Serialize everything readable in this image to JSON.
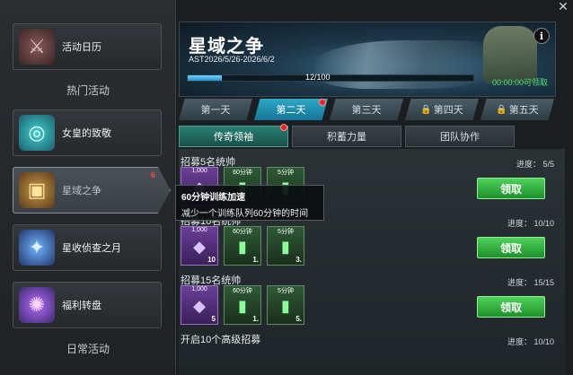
{
  "sidebar": {
    "items": [
      {
        "label": "活动日历",
        "icon": "swords-icon",
        "badge": ""
      },
      {
        "label": "女皇的致敬",
        "icon": "crest-icon",
        "badge": ""
      },
      {
        "label": "星域之争",
        "icon": "treasure-chest-icon",
        "badge": "6"
      },
      {
        "label": "星收侦查之月",
        "icon": "crystal-icon",
        "badge": ""
      },
      {
        "label": "福利转盘",
        "icon": "wheel-icon",
        "badge": ""
      }
    ],
    "section_hot": "热门活动",
    "section_daily": "日常活动"
  },
  "banner": {
    "title": "星域之争",
    "date": "AST2026/5/26-2026/6/2",
    "progress_text": "12/100",
    "progress": 0.12,
    "claim_time": "00:00:00可领取",
    "info": "i"
  },
  "days": [
    {
      "label": "第一天",
      "locked": false,
      "selected": false
    },
    {
      "label": "第二天",
      "locked": false,
      "selected": true
    },
    {
      "label": "第三天",
      "locked": false,
      "selected": false
    },
    {
      "label": "第四天",
      "locked": true,
      "selected": false
    },
    {
      "label": "第五天",
      "locked": true,
      "selected": false
    }
  ],
  "subtabs": [
    {
      "label": "传奇领袖",
      "selected": true
    },
    {
      "label": "积蓄力量",
      "selected": false
    },
    {
      "label": "团队协作",
      "selected": false
    }
  ],
  "tasks": [
    {
      "title": "招募5名统帅",
      "progress": "进度： 5/5",
      "button": "领取",
      "rewards": [
        {
          "top": "1,000",
          "count": "",
          "color": "purple"
        },
        {
          "top": "60分钟",
          "count": "",
          "color": "green"
        },
        {
          "top": "5分钟",
          "count": "",
          "color": "green"
        }
      ]
    },
    {
      "title": "招募10名统帅",
      "progress": "进度： 10/10",
      "button": "领取",
      "rewards": [
        {
          "top": "1,000",
          "count": "10",
          "color": "purple"
        },
        {
          "top": "60分钟",
          "count": "1.",
          "color": "green"
        },
        {
          "top": "5分钟",
          "count": "3.",
          "color": "green"
        }
      ]
    },
    {
      "title": "招募15名统帅",
      "progress": "进度： 15/15",
      "button": "领取",
      "rewards": [
        {
          "top": "1,000",
          "count": "5",
          "color": "purple"
        },
        {
          "top": "60分钟",
          "count": "1.",
          "color": "green"
        },
        {
          "top": "5分钟",
          "count": "5.",
          "color": "green"
        }
      ]
    },
    {
      "title": "开启10个高级招募",
      "progress": "进度： 10/10",
      "button": "",
      "rewards": []
    }
  ],
  "tooltip": {
    "title": "60分钟训练加速",
    "desc": "减少一个训练队列60分钟的时间"
  }
}
